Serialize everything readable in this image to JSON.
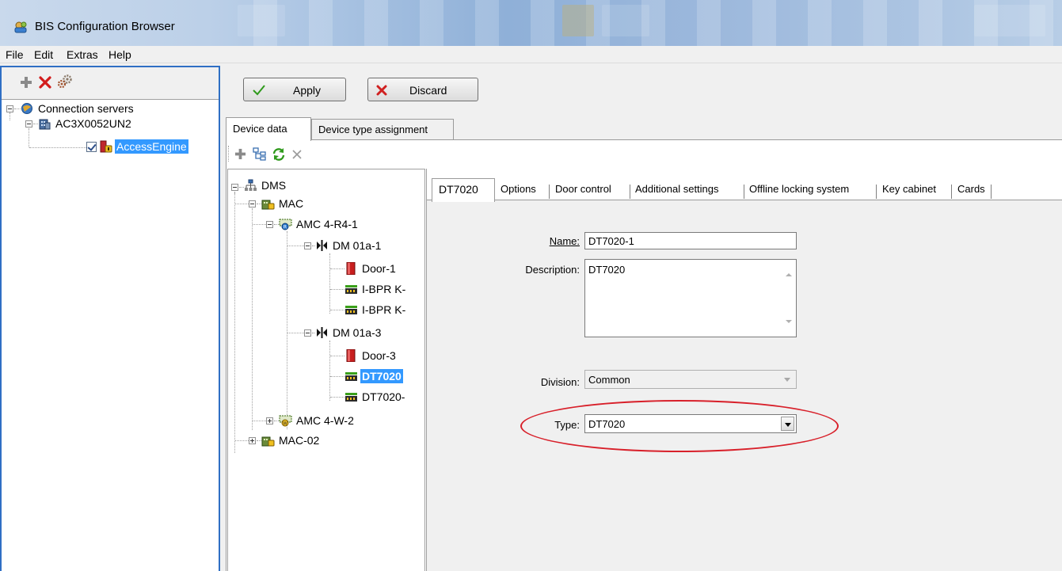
{
  "window": {
    "title": "BIS Configuration Browser"
  },
  "menu": {
    "items": [
      "File",
      "Edit",
      "Extras",
      "Help"
    ]
  },
  "left_tree": {
    "root": "Connection servers",
    "server": "AC3X0052UN2",
    "engine": "AccessEngine"
  },
  "actions": {
    "apply": "Apply",
    "discard": "Discard"
  },
  "outer_tabs": [
    "Device data",
    "Device type assignment"
  ],
  "device_tree": {
    "dms": "DMS",
    "mac": "MAC",
    "amc1": "AMC 4-R4-1",
    "dm1": "DM 01a-1",
    "door1": "Door-1",
    "bpr1": "I-BPR K-",
    "bpr2": "I-BPR K-",
    "dm3": "DM 01a-3",
    "door3": "Door-3",
    "dt1": "DT7020",
    "dt2": "DT7020-",
    "amc2": "AMC 4-W-2",
    "mac2": "MAC-02"
  },
  "detail_tabs": [
    "DT7020",
    "Options",
    "Door control",
    "Additional settings",
    "Offline locking system",
    "Key cabinet",
    "Cards"
  ],
  "form": {
    "name_label": "Name:",
    "name_value": "DT7020-1",
    "description_label": "Description:",
    "description_value": "DT7020",
    "division_label": "Division:",
    "division_value": "Common",
    "type_label": "Type:",
    "type_value": "DT7020"
  },
  "colors": {
    "selection": "#3399ff",
    "highlight_ellipse": "#d8202a",
    "apply_check": "#2f9a1c",
    "discard_x": "#d02020"
  },
  "icons": [
    "plus-icon",
    "delete-icon",
    "settings-gears-icon",
    "refresh-icon",
    "tree-structure-icon",
    "close-icon"
  ]
}
